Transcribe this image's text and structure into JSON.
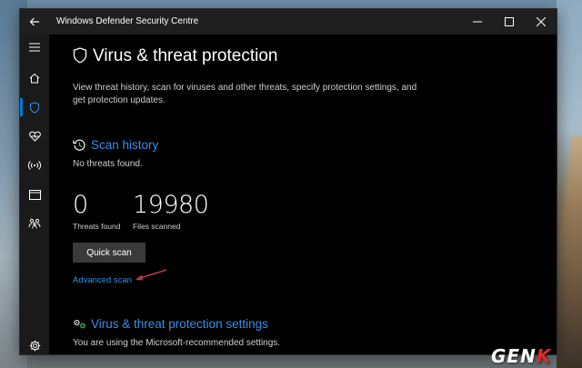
{
  "window": {
    "title": "Windows Defender Security Centre",
    "back_icon": "arrow-left-icon",
    "minimize_icon": "minimize-icon",
    "maximize_icon": "maximize-icon",
    "close_icon": "close-icon"
  },
  "sidebar": {
    "items": [
      {
        "icon": "hamburger-menu-icon"
      },
      {
        "icon": "home-icon"
      },
      {
        "icon": "shield-icon",
        "active": true
      },
      {
        "icon": "heart-icon"
      },
      {
        "icon": "wireless-icon"
      },
      {
        "icon": "browser-icon"
      },
      {
        "icon": "family-icon"
      },
      {
        "icon": "gear-icon"
      }
    ]
  },
  "page": {
    "title": "Virus & threat protection",
    "description": "View threat history, scan for viruses and other threats, specify protection settings, and get protection updates."
  },
  "scan_history": {
    "title": "Scan history",
    "status": "No threats found.",
    "stats": [
      {
        "value": "0",
        "label": "Threats found"
      },
      {
        "value": "19980",
        "label": "Files scanned"
      }
    ],
    "quick_scan_label": "Quick scan",
    "advanced_scan_label": "Advanced scan"
  },
  "settings": {
    "title": "Virus & threat protection settings",
    "status": "You are using the Microsoft-recommended settings."
  },
  "watermark": {
    "text_main": "GEN",
    "text_accent": "K"
  },
  "colors": {
    "accent": "#0078d7",
    "link": "#3a8ee6",
    "annotation_arrow": "#c0394b"
  }
}
